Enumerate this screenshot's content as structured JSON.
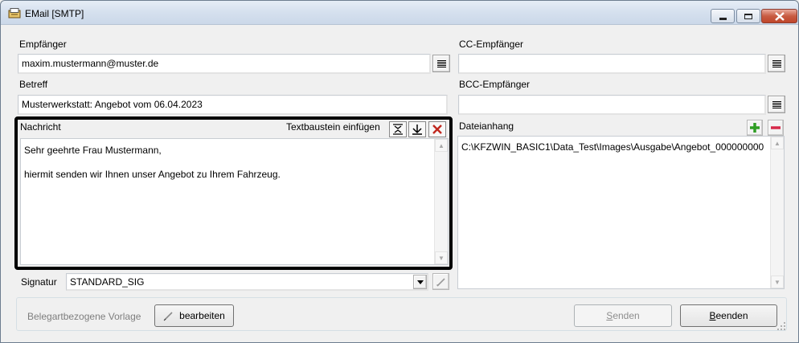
{
  "window": {
    "title": "EMail [SMTP]"
  },
  "fields": {
    "empfaenger_label": "Empfänger",
    "empfaenger_value": "maxim.mustermann@muster.de",
    "cc_label": "CC-Empfänger",
    "cc_value": "",
    "betreff_label": "Betreff",
    "betreff_value": "Musterwerkstatt: Angebot vom 06.04.2023",
    "bcc_label": "BCC-Empfänger",
    "bcc_value": ""
  },
  "nachricht": {
    "label": "Nachricht",
    "textbaustein_label": "Textbaustein einfügen",
    "lines": [
      "Sehr geehrte Frau Mustermann,",
      "hiermit senden wir Ihnen unser Angebot zu Ihrem Fahrzeug."
    ]
  },
  "signatur": {
    "label": "Signatur",
    "value": "STANDARD_SIG"
  },
  "attachments": {
    "label": "Dateianhang",
    "items": [
      "C:\\KFZWIN_BASIC1\\Data_Test\\Images\\Ausgabe\\Angebot_000000000"
    ]
  },
  "footer": {
    "vorlage_label": "Belegartbezogene Vorlage",
    "bearbeiten_label": "bearbeiten",
    "senden_label_u": "S",
    "senden_label_rest": "enden",
    "beenden_label_u": "B",
    "beenden_label_rest": "eenden"
  },
  "icons": {
    "app": "envelope-printer-icon",
    "list": "list-icon",
    "add": "plus-icon",
    "remove": "minus-icon",
    "expand": "expand-icon",
    "download": "download-arrow-icon",
    "delete": "close-x-icon",
    "edit": "pencil-icon"
  },
  "colors": {
    "accent_green": "#2f9e24",
    "accent_red": "#d6294a",
    "delete_red": "#c0281f"
  }
}
